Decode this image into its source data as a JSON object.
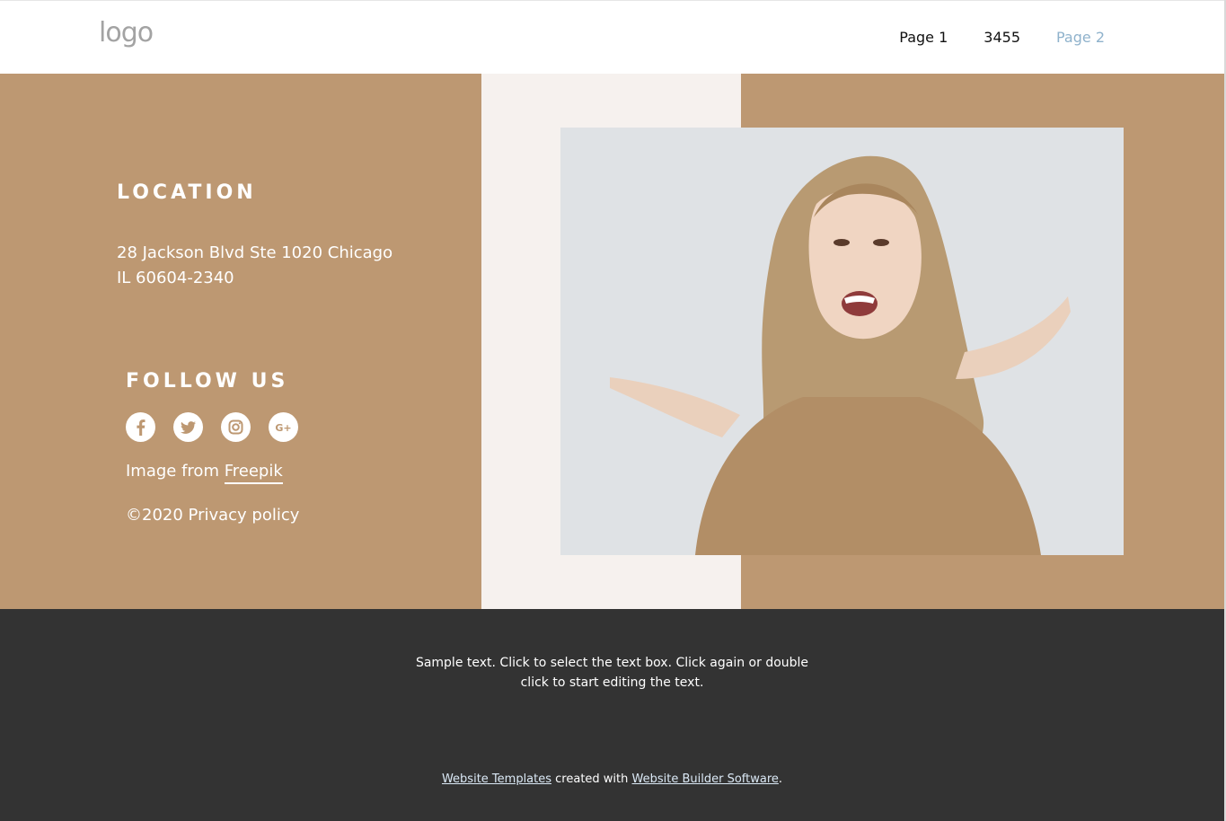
{
  "header": {
    "logo": "logo",
    "nav": [
      "Page 1",
      "3455",
      "Page 2"
    ]
  },
  "location": {
    "title": "LOCATION",
    "address_line1": "28 Jackson Blvd Ste 1020 Chicago",
    "address_line2": "IL 60604-2340"
  },
  "follow": {
    "title": "FOLLOW US",
    "icons": [
      "facebook-icon",
      "twitter-icon",
      "instagram-icon",
      "google-plus-icon"
    ],
    "credit_prefix": "Image from ",
    "credit_link": "Freepik",
    "copyright": "©2020 Privacy policy"
  },
  "footer": {
    "sample_line1": "Sample text. Click to select the text box. Click again or double",
    "sample_line2": "click to start editing the text.",
    "link1": "Website Templates",
    "middle": " created with ",
    "link2": "Website Builder Software",
    "end": "."
  },
  "colors": {
    "tan": "#bd9872",
    "cream": "#f6f1ee",
    "footer": "#333333",
    "nav_active": "#8fb2cc"
  }
}
